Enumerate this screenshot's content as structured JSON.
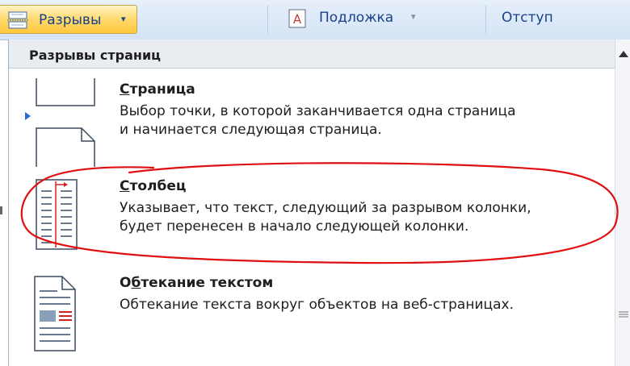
{
  "ribbon": {
    "breaks_label": "Разрывы",
    "breaks_arrow": "▾",
    "watermark_label": "Подложка",
    "watermark_arrow": "▾",
    "indent_label": "Отступ"
  },
  "menu": {
    "header": "Разрывы страниц",
    "items": [
      {
        "title_accel": "С",
        "title_rest": "траница",
        "description": "Выбор точки, в которой заканчивается одна страница\nи начинается следующая страница.",
        "icon": "page-break-icon"
      },
      {
        "title_accel": "С",
        "title_rest": "толбец",
        "description": "Указывает, что текст, следующий за разрывом колонки,\nбудет перенесен в начало следующей колонки.",
        "icon": "column-break-icon"
      },
      {
        "title_pre": "О",
        "title_accel": "б",
        "title_rest": "текание текстом",
        "description": "Обтекание текста вокруг объектов на веб-страницах.",
        "icon": "text-wrapping-icon"
      }
    ]
  },
  "colors": {
    "ribbon_text": "#15428b",
    "highlight": "#ffd767",
    "annotation": "#e01010"
  }
}
